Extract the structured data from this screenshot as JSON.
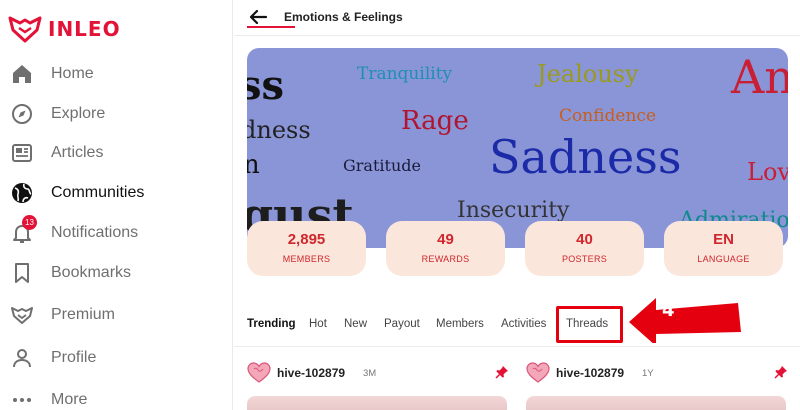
{
  "app": {
    "name": "INLEO",
    "brand_color": "#e31337"
  },
  "sidebar": {
    "items": [
      {
        "label": "Home",
        "icon": "home-icon"
      },
      {
        "label": "Explore",
        "icon": "compass-icon"
      },
      {
        "label": "Articles",
        "icon": "newspaper-icon"
      },
      {
        "label": "Communities",
        "icon": "globe-icon",
        "active": true
      },
      {
        "label": "Notifications",
        "icon": "bell-icon",
        "badge": "13"
      },
      {
        "label": "Bookmarks",
        "icon": "bookmark-icon"
      },
      {
        "label": "Premium",
        "icon": "leo-icon"
      },
      {
        "label": "Profile",
        "icon": "user-icon"
      },
      {
        "label": "More",
        "icon": "dots-icon"
      }
    ]
  },
  "header": {
    "title": "Emotions & Feelings",
    "back_icon": "arrow-left-icon"
  },
  "banner": {
    "words": [
      "ss",
      "Tranquility",
      "Jealousy",
      "An",
      "dness",
      "Rage",
      "Confidence",
      "Gratitude",
      "Sadness",
      "n",
      "Lov",
      "gust",
      "Insecurity",
      "Admiration"
    ]
  },
  "stats": [
    {
      "value": "2,895",
      "label": "MEMBERS"
    },
    {
      "value": "49",
      "label": "REWARDS"
    },
    {
      "value": "40",
      "label": "POSTERS"
    },
    {
      "value": "EN",
      "label": "LANGUAGE"
    }
  ],
  "tabs": [
    "Trending",
    "Hot",
    "New",
    "Payout",
    "Members",
    "Activities",
    "Threads"
  ],
  "annotation": {
    "number": "4",
    "color": "#e5000f"
  },
  "posts": [
    {
      "user": "hive-102879",
      "age": "3M"
    },
    {
      "user": "hive-102879",
      "age": "1Y"
    }
  ]
}
